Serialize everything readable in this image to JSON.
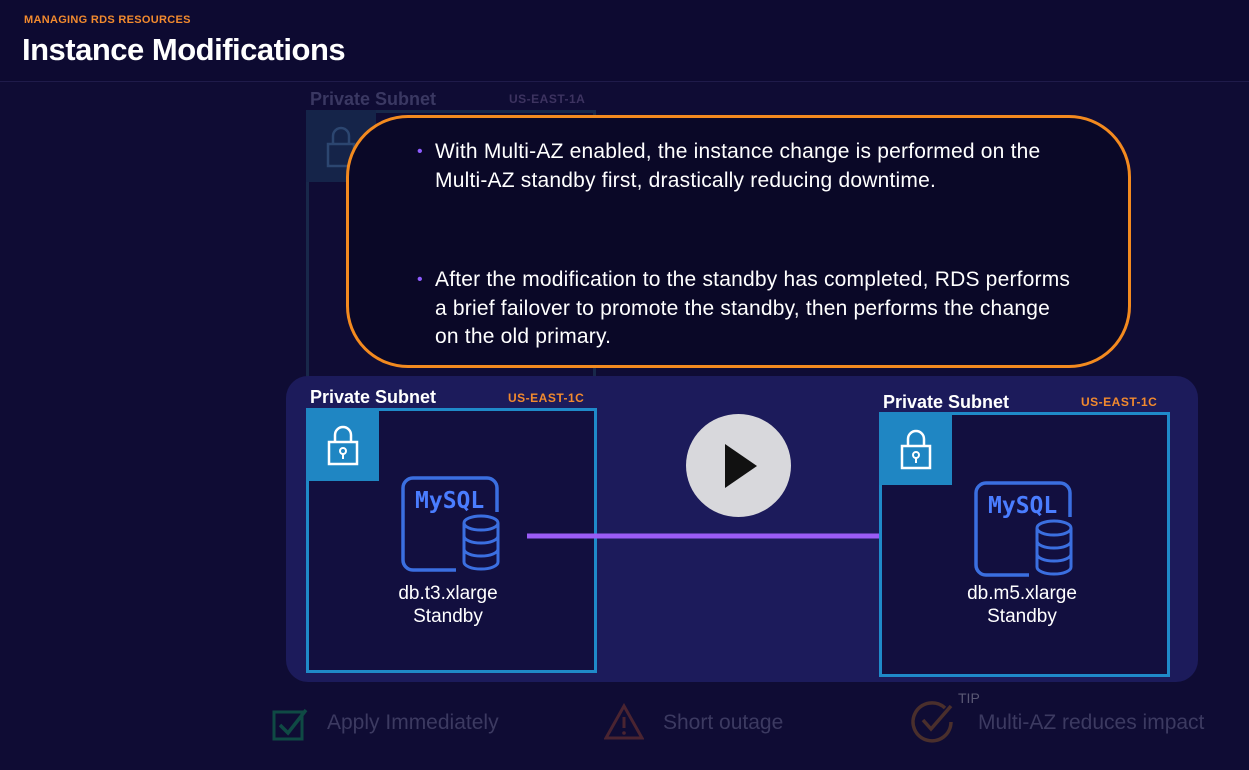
{
  "header": {
    "kicker": "MANAGING RDS RESOURCES",
    "title": "Instance Modifications"
  },
  "background_subnet": {
    "label": "Private Subnet",
    "az": "US-EAST-1A"
  },
  "callout": {
    "bullets": [
      "With Multi-AZ enabled, the instance change is performed on the Multi-AZ standby first, drastically reducing downtime.",
      "After the modification to the standby has completed, RDS performs a brief failover to promote the standby, then performs the change on the old primary."
    ]
  },
  "diagram": {
    "left": {
      "subnet_label": "Private Subnet",
      "az": "US-EAST-1C",
      "db_logo": "MySQL",
      "instance_class": "db.t3.xlarge",
      "role": "Standby"
    },
    "right": {
      "subnet_label": "Private Subnet",
      "az": "US-EAST-1C",
      "db_logo": "MySQL",
      "instance_class": "db.m5.xlarge",
      "role": "Standby"
    },
    "arrow_color": "#9b5cf6"
  },
  "tips": {
    "apply_immediately": "Apply Immediately",
    "short_outage": "Short outage",
    "tip_tag": "TIP",
    "multi_az": "Multi-AZ reduces impact"
  },
  "colors": {
    "accent_orange": "#f38a1f",
    "subnet_blue": "#1f8ac9",
    "db_blue": "#3b6fe0",
    "purple": "#9b5cf6"
  }
}
